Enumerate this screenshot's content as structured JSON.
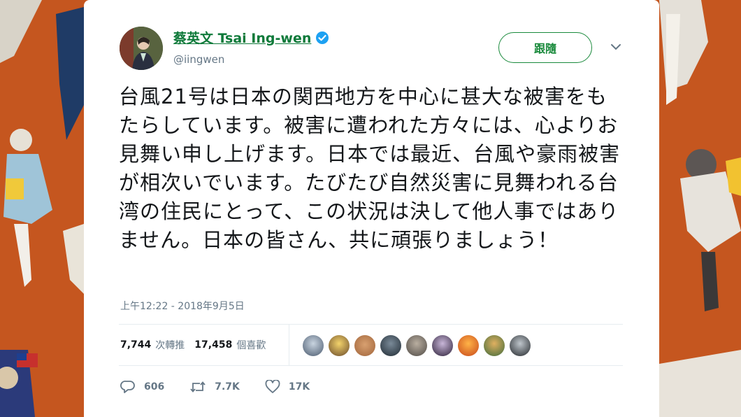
{
  "tweet": {
    "display_name": "蔡英文 Tsai Ing-wen",
    "handle": "@iingwen",
    "follow_label": "跟隨",
    "text": "台風21号は日本の関西地方を中心に甚大な被害をもたらしています。被害に遭われた方々には、心よりお見舞い申し上げます。日本では最近、台風や豪雨被害が相次いでいます。たびたび自然災害に見舞われる台湾の住民にとって、この状況は決して他人事ではありません。日本の皆さん、共に頑張りましょう！",
    "timestamp": "上午12:22 - 2018年9月5日",
    "retweets_count": "7,744",
    "retweets_label": "次轉推",
    "likes_count": "17,458",
    "likes_label": "個喜歡",
    "reply_count": "606",
    "retweet_action_count": "7.7K",
    "like_action_count": "17K"
  },
  "colors": {
    "background": "#c5561f",
    "name_green": "#0f7a3a",
    "follow_green": "#1a8a3c",
    "verified_blue": "#1da1f2",
    "muted": "#657786"
  }
}
